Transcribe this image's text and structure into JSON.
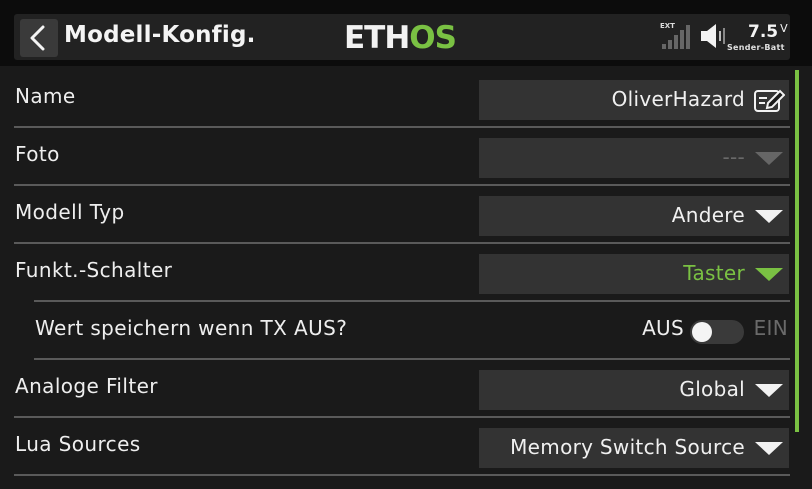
{
  "header": {
    "back_icon": "chevron-left-icon",
    "title": "Modell-Konfig.",
    "logo_main": "ETH",
    "logo_accent": "OS",
    "signal_label": "EXT",
    "battery_value": "7.5",
    "battery_unit": "V",
    "battery_label": "Sender-Batt"
  },
  "rows": [
    {
      "label": "Name",
      "value": "OliverHazard",
      "control": "text-edit",
      "icon": "edit-icon"
    },
    {
      "label": "Foto",
      "value": "---",
      "control": "dropdown",
      "state": "disabled"
    },
    {
      "label": "Modell Typ",
      "value": "Andere",
      "control": "dropdown"
    },
    {
      "label": "Funkt.-Schalter",
      "value": "Taster",
      "control": "dropdown",
      "state": "highlighted"
    },
    {
      "label": "Wert speichern wenn TX AUS?",
      "control": "toggle",
      "off_label": "AUS",
      "on_label": "EIN",
      "checked": false
    },
    {
      "label": "Analoge Filter",
      "value": "Global",
      "control": "dropdown"
    },
    {
      "label": "Lua Sources",
      "value": "Memory Switch Source",
      "control": "dropdown"
    }
  ],
  "colors": {
    "accent": "#7ac143",
    "background": "#1a1a1a",
    "field": "#333333",
    "divider": "#5a5a5a"
  }
}
